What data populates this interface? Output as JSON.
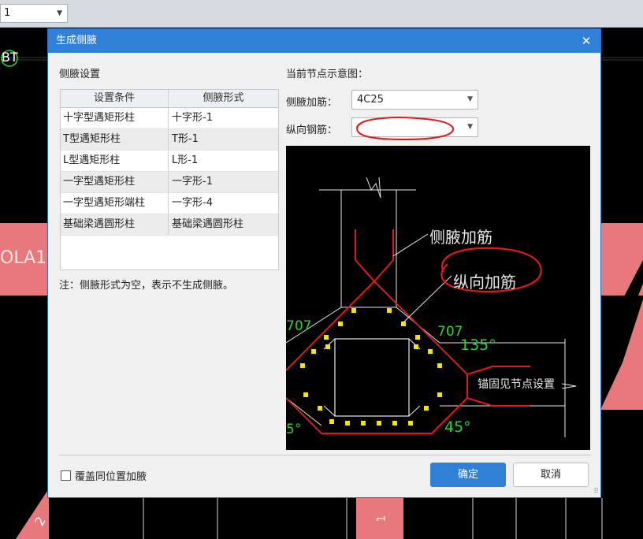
{
  "topbar": {
    "combo_value": "1"
  },
  "cad": {
    "label_bt": "BT",
    "label_ola": "OLA1",
    "label_zone": "2",
    "label_bottom": "1"
  },
  "dialog": {
    "title": "生成侧腋",
    "close_glyph": "✕",
    "settings_title": "侧腋设置",
    "table": {
      "headers": [
        "设置条件",
        "侧腋形式"
      ],
      "rows": [
        [
          "十字型遇矩形柱",
          "十字形-1"
        ],
        [
          "T型遇矩形柱",
          "T形-1"
        ],
        [
          "L型遇矩形柱",
          "L形-1"
        ],
        [
          "一字型遇矩形柱",
          "一字形-1"
        ],
        [
          "一字型遇矩形端柱",
          "一字形-4"
        ],
        [
          "基础梁遇圆形柱",
          "基础梁遇圆形柱"
        ]
      ]
    },
    "note": "注：侧腋形式为空，表示不生成侧腋。",
    "preview_title": "当前节点示意图：",
    "haunch_rebar_label": "侧腋加筋：",
    "haunch_rebar_value": "4C25",
    "long_rebar_label": "纵向钢筋：",
    "long_rebar_value": "",
    "diagram_labels": {
      "haunch": "侧腋加筋",
      "longitudinal": "纵向加筋",
      "anchor": "锚固见节点设置",
      "dim_left": "707",
      "dim_right": "707",
      "angle_135": "135°",
      "angle_45": "45°",
      "dim_bottom_left": "5°"
    },
    "overwrite_label": "覆盖同位置加腋",
    "ok_label": "确定",
    "cancel_label": "取消"
  },
  "colors": {
    "title_bar": "#2f80d6",
    "cad_pink": "#e8787b",
    "rebar_red": "#e01a1a",
    "dim_green": "#2fd22f",
    "stirrup_yellow": "#f2e600"
  }
}
